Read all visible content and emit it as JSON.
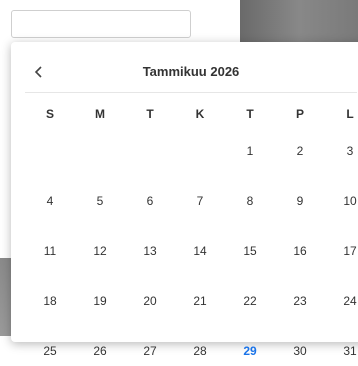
{
  "input": {
    "value": "",
    "placeholder": ""
  },
  "calendar": {
    "month_title": "Tammikuu 2026",
    "prev_icon": "chevron-left-icon",
    "weekdays": [
      "S",
      "M",
      "T",
      "K",
      "T",
      "P",
      "L"
    ],
    "weeks": [
      [
        "",
        "",
        "",
        "",
        "1",
        "2",
        "3"
      ],
      [
        "4",
        "5",
        "6",
        "7",
        "8",
        "9",
        "10"
      ],
      [
        "11",
        "12",
        "13",
        "14",
        "15",
        "16",
        "17"
      ],
      [
        "18",
        "19",
        "20",
        "21",
        "22",
        "23",
        "24"
      ],
      [
        "25",
        "26",
        "27",
        "28",
        "29",
        "30",
        "31"
      ]
    ],
    "today": "29",
    "today_color": "#1a73e8"
  }
}
